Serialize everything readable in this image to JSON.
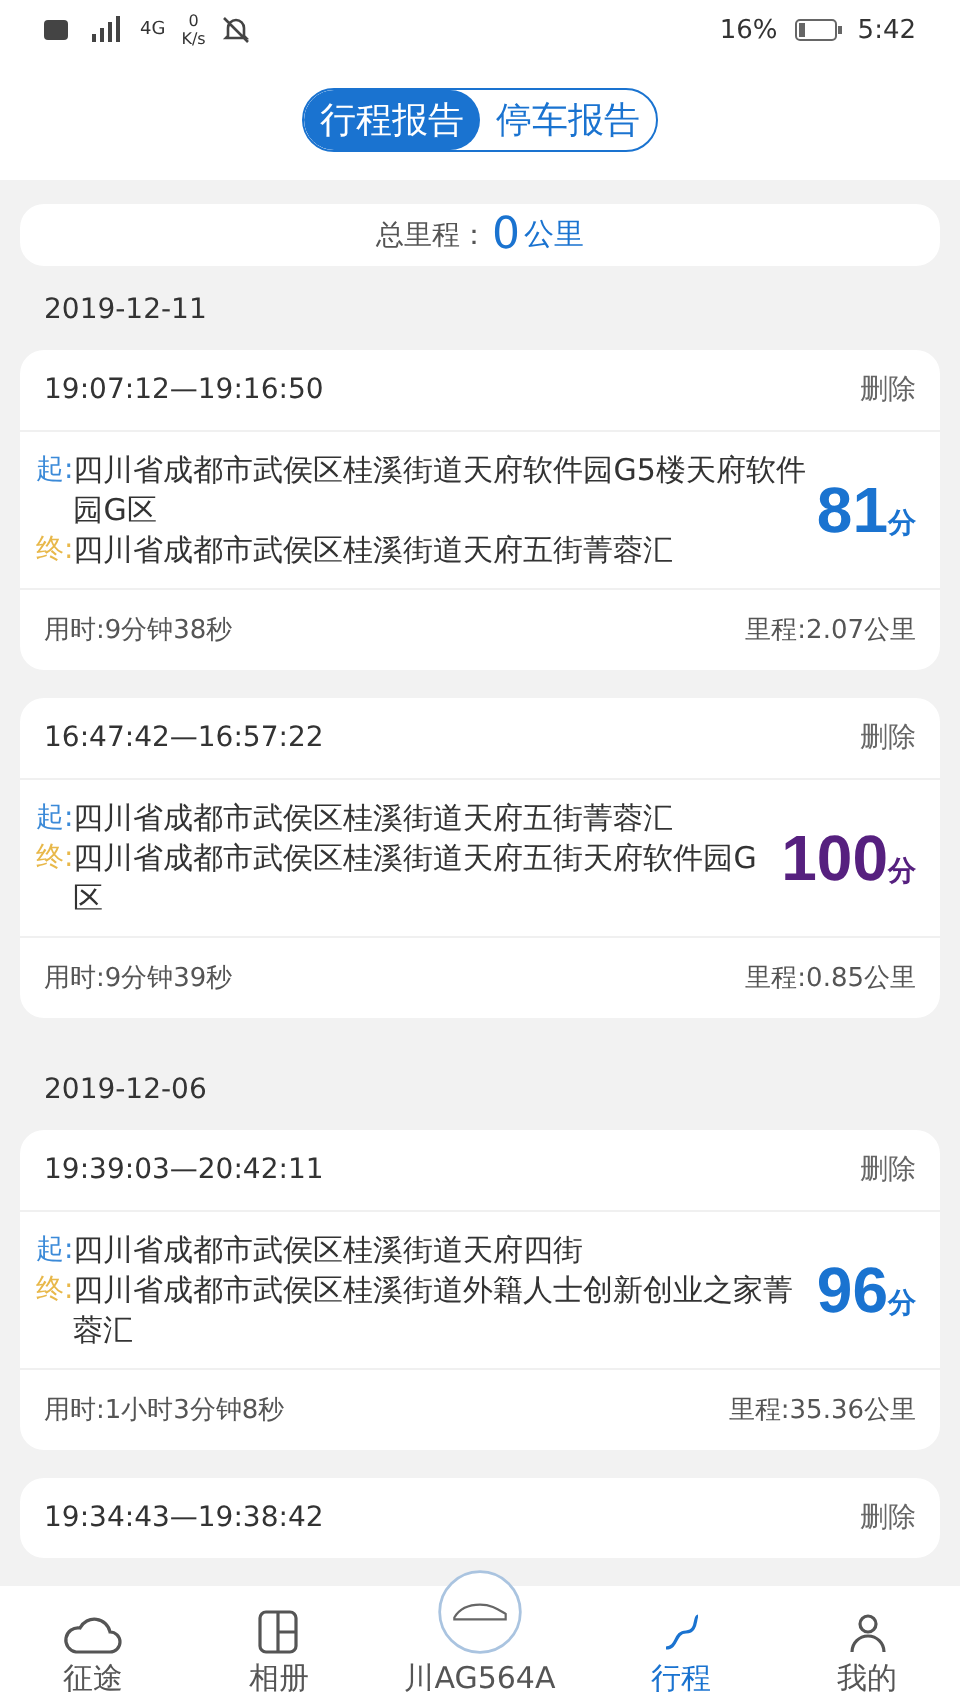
{
  "status_bar": {
    "network": "4G",
    "speed_value": "0",
    "speed_unit": "K/s",
    "battery": "16%",
    "time": "5:42"
  },
  "tabs": [
    {
      "label": "行程报告",
      "selected": true
    },
    {
      "label": "停车报告",
      "selected": false
    }
  ],
  "summary": {
    "label": "总里程：",
    "value": "0",
    "unit": "公里"
  },
  "groups": [
    {
      "date": "2019-12-11",
      "trips": [
        {
          "time": "19:07:12—19:16:50",
          "delete": "删除",
          "start_label": "起:",
          "start": "四川省成都市武侯区桂溪街道天府软件园G5楼天府软件园G区",
          "end_label": "终:",
          "end": "四川省成都市武侯区桂溪街道天府五街菁蓉汇",
          "score": "81",
          "score_unit": "分",
          "color": "#1a73d0",
          "duration": "用时:9分钟38秒",
          "distance": "里程:2.07公里"
        },
        {
          "time": "16:47:42—16:57:22",
          "delete": "删除",
          "start_label": "起:",
          "start": "四川省成都市武侯区桂溪街道天府五街菁蓉汇",
          "end_label": "终:",
          "end": "四川省成都市武侯区桂溪街道天府五街天府软件园G区",
          "score": "100",
          "score_unit": "分",
          "color": "#56207f",
          "duration": "用时:9分钟39秒",
          "distance": "里程:0.85公里"
        }
      ]
    },
    {
      "date": "2019-12-06",
      "trips": [
        {
          "time": "19:39:03—20:42:11",
          "delete": "删除",
          "start_label": "起:",
          "start": "四川省成都市武侯区桂溪街道天府四街",
          "end_label": "终:",
          "end": "四川省成都市武侯区桂溪街道外籍人士创新创业之家菁蓉汇",
          "score": "96",
          "score_unit": "分",
          "color": "#1a73d0",
          "duration": "用时:1小时3分钟8秒",
          "distance": "里程:35.36公里"
        },
        {
          "time": "19:34:43—19:38:42",
          "delete": "删除"
        }
      ]
    }
  ],
  "nav": [
    {
      "label": "征途",
      "kind": "cloud",
      "selected": false
    },
    {
      "label": "相册",
      "kind": "album",
      "selected": false
    },
    {
      "label": "川AG564A",
      "kind": "car",
      "selected": false
    },
    {
      "label": "行程",
      "kind": "trip",
      "selected": true
    },
    {
      "label": "我的",
      "kind": "user",
      "selected": false
    }
  ]
}
